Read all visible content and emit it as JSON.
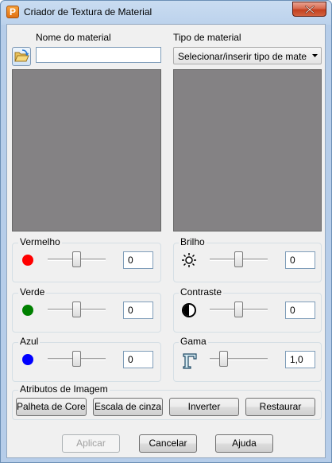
{
  "window": {
    "title": "Criador de Textura de Material",
    "app_icon_letter": "P"
  },
  "material": {
    "name_label": "Nome do material",
    "name_value": "",
    "type_label": "Tipo de material",
    "type_value": "Selecionar/inserir tipo de mate"
  },
  "rgb": {
    "red": {
      "label": "Vermelho",
      "value": "0",
      "color": "#ff0000",
      "slider_fraction": 0.5
    },
    "green": {
      "label": "Verde",
      "value": "0",
      "color": "#008000",
      "slider_fraction": 0.5
    },
    "blue": {
      "label": "Azul",
      "value": "0",
      "color": "#0000ff",
      "slider_fraction": 0.5
    }
  },
  "adjust": {
    "brightness": {
      "label": "Brilho",
      "value": "0",
      "icon": "sun-icon",
      "slider_fraction": 0.5
    },
    "contrast": {
      "label": "Contraste",
      "value": "0",
      "icon": "contrast-icon",
      "slider_fraction": 0.5
    },
    "gamma": {
      "label": "Gama",
      "value": "1,0",
      "icon": "gamma-icon",
      "slider_fraction": 0.2
    }
  },
  "image_attributes": {
    "label": "Atributos de Imagem",
    "buttons": [
      "Palheta de Cores",
      "Escala de cinza",
      "Inverter",
      "Restaurar"
    ]
  },
  "footer": {
    "apply": "Aplicar",
    "cancel": "Cancelar",
    "help": "Ajuda"
  },
  "colors": {
    "preview_bg": "#848284",
    "title_bar": "#bcd2ec",
    "dialog_bg": "#f0f0f0"
  }
}
